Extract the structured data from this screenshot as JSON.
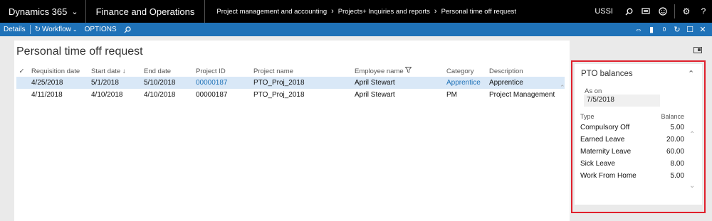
{
  "topbar": {
    "app_name": "Dynamics 365",
    "module": "Finance and Operations",
    "breadcrumb": [
      "Project management and accounting",
      "Projects+ Inquiries and reports",
      "Personal time off request"
    ],
    "company": "USSI"
  },
  "actionbar": {
    "details": "Details",
    "workflow": "Workflow",
    "options": "OPTIONS",
    "notification_count": "0"
  },
  "page": {
    "title": "Personal time off request"
  },
  "grid": {
    "columns": [
      "Requisition date",
      "Start date",
      "End date",
      "Project ID",
      "Project name",
      "Employee name",
      "Category",
      "Description"
    ],
    "rows": [
      {
        "req": "4/25/2018",
        "start": "5/1/2018",
        "end": "5/10/2018",
        "project_id": "00000187",
        "project_name": "PTO_Proj_2018",
        "employee": "April Stewart",
        "category": "Apprentice",
        "description": "Apprentice"
      },
      {
        "req": "4/11/2018",
        "start": "4/10/2018",
        "end": "4/10/2018",
        "project_id": "00000187",
        "project_name": "PTO_Proj_2018",
        "employee": "April Stewart",
        "category": "PM",
        "description": "Project Management"
      }
    ]
  },
  "pto": {
    "title": "PTO balances",
    "as_on_label": "As on",
    "as_on_value": "7/5/2018",
    "type_header": "Type",
    "balance_header": "Balance",
    "rows": [
      {
        "type": "Compulsory Off",
        "balance": "5.00"
      },
      {
        "type": "Earned Leave",
        "balance": "20.00"
      },
      {
        "type": "Maternity Leave",
        "balance": "60.00"
      },
      {
        "type": "Sick Leave",
        "balance": "8.00"
      },
      {
        "type": "Work From Home",
        "balance": "5.00"
      }
    ]
  },
  "colors": {
    "accent": "#1f72b8",
    "highlight_frame": "#e0202c",
    "selected_row": "#d9e8f7"
  }
}
